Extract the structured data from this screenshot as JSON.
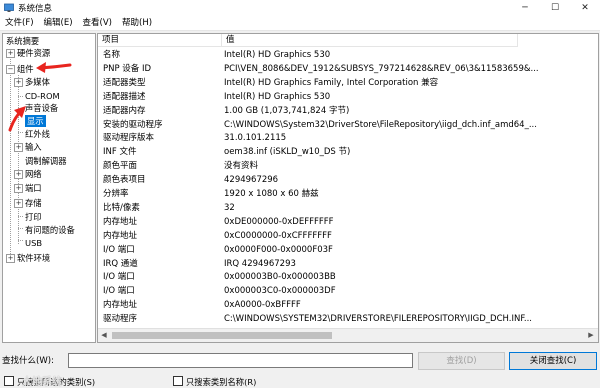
{
  "window": {
    "title": "系统信息",
    "minimize_glyph": "─",
    "maximize_glyph": "☐",
    "close_glyph": "✕"
  },
  "menu": [
    {
      "label": "文件(F)"
    },
    {
      "label": "编辑(E)"
    },
    {
      "label": "查看(V)"
    },
    {
      "label": "帮助(H)"
    }
  ],
  "tree": {
    "root": "系统摘要",
    "hardware": "硬件资源",
    "components": "组件",
    "multimedia": "多媒体",
    "cdrom": "CD-ROM",
    "sound": "声音设备",
    "display": "显示",
    "infrared": "红外线",
    "input": "输入",
    "modem": "调制解调器",
    "network": "网络",
    "ports": "端口",
    "storage": "存储",
    "printing": "打印",
    "problem_devices": "有问题的设备",
    "usb": "USB",
    "software_env": "软件环境"
  },
  "table": {
    "headers": [
      "项目",
      "值"
    ],
    "rows": [
      [
        "名称",
        "Intel(R) HD Graphics 530"
      ],
      [
        "PNP 设备 ID",
        "PCI\\VEN_8086&DEV_1912&SUBSYS_797214628&REV_06\\3&11583659&..."
      ],
      [
        "适配器类型",
        "Intel(R) HD Graphics Family, Intel Corporation 兼容"
      ],
      [
        "适配器描述",
        "Intel(R) HD Graphics 530"
      ],
      [
        "适配器内存",
        "1.00 GB (1,073,741,824 字节)"
      ],
      [
        "安装的驱动程序",
        "C:\\WINDOWS\\System32\\DriverStore\\FileRepository\\iigd_dch.inf_amd64_..."
      ],
      [
        "驱动程序版本",
        "31.0.101.2115"
      ],
      [
        "INF 文件",
        "oem38.inf (iSKLD_w10_DS 节)"
      ],
      [
        "颜色平面",
        "没有资料"
      ],
      [
        "颜色表项目",
        "4294967296"
      ],
      [
        "分辨率",
        "1920 x 1080 x 60 赫兹"
      ],
      [
        "比特/像素",
        "32"
      ],
      [
        "内存地址",
        "0xDE000000-0xDEFFFFFF"
      ],
      [
        "内存地址",
        "0xC0000000-0xCFFFFFFF"
      ],
      [
        "I/O 端口",
        "0x0000F000-0x0000F03F"
      ],
      [
        "IRQ 通道",
        "IRQ 4294967293"
      ],
      [
        "I/O 端口",
        "0x000003B0-0x000003BB"
      ],
      [
        "I/O 端口",
        "0x000003C0-0x000003DF"
      ],
      [
        "内存地址",
        "0xA0000-0xBFFFF"
      ],
      [
        "驱动程序",
        "C:\\WINDOWS\\SYSTEM32\\DRIVERSTORE\\FILEREPOSITORY\\IIGD_DCH.INF..."
      ]
    ]
  },
  "search": {
    "label": "查找什么(W):",
    "value": "",
    "find_button": "查找(D)",
    "close_find_button": "关闭查找(C)",
    "option_selected_category": "只搜索所选的类别(S)",
    "option_category_names": "只搜索类别名称(R)"
  },
  "watermark": "大地系统",
  "colors": {
    "selection": "#0078d7",
    "annotation_arrow": "#e8251f"
  }
}
